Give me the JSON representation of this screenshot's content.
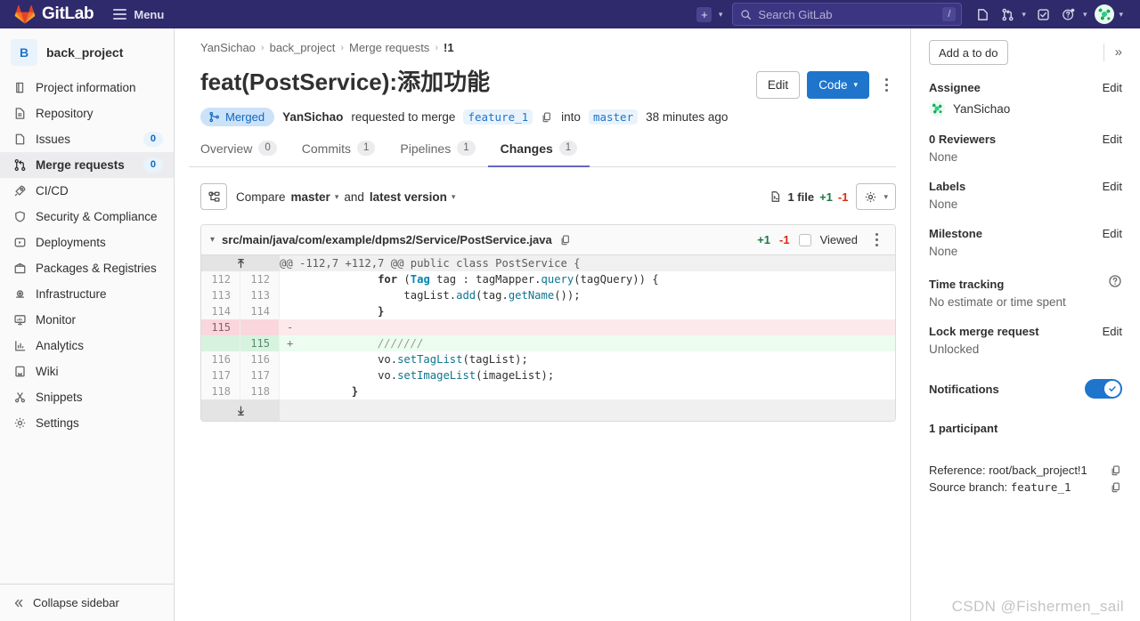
{
  "topnav": {
    "brand": "GitLab",
    "menu_label": "Menu",
    "search_placeholder": "Search GitLab",
    "search_value": "",
    "slash_key": "/",
    "plus_icon": "plus-icon",
    "icons": [
      "issues-icon",
      "merge-requests-icon",
      "todos-icon",
      "help-icon",
      "user-avatar"
    ]
  },
  "sidebar": {
    "project_initial": "B",
    "project_name": "back_project",
    "items": [
      {
        "label": "Project information",
        "icon": "project-info-icon",
        "badge": "",
        "active": false
      },
      {
        "label": "Repository",
        "icon": "repository-icon",
        "badge": "",
        "active": false
      },
      {
        "label": "Issues",
        "icon": "issues-icon",
        "badge": "0",
        "active": false
      },
      {
        "label": "Merge requests",
        "icon": "merge-requests-icon",
        "badge": "0",
        "active": true
      },
      {
        "label": "CI/CD",
        "icon": "rocket-icon",
        "badge": "",
        "active": false
      },
      {
        "label": "Security & Compliance",
        "icon": "shield-icon",
        "badge": "",
        "active": false
      },
      {
        "label": "Deployments",
        "icon": "deployments-icon",
        "badge": "",
        "active": false
      },
      {
        "label": "Packages & Registries",
        "icon": "package-icon",
        "badge": "",
        "active": false
      },
      {
        "label": "Infrastructure",
        "icon": "infrastructure-icon",
        "badge": "",
        "active": false
      },
      {
        "label": "Monitor",
        "icon": "monitor-icon",
        "badge": "",
        "active": false
      },
      {
        "label": "Analytics",
        "icon": "analytics-icon",
        "badge": "",
        "active": false
      },
      {
        "label": "Wiki",
        "icon": "wiki-icon",
        "badge": "",
        "active": false
      },
      {
        "label": "Snippets",
        "icon": "snippets-icon",
        "badge": "",
        "active": false
      },
      {
        "label": "Settings",
        "icon": "gear-icon",
        "badge": "",
        "active": false
      }
    ],
    "collapse_label": "Collapse sidebar"
  },
  "breadcrumb": [
    {
      "label": "YanSichao",
      "current": false
    },
    {
      "label": "back_project",
      "current": false
    },
    {
      "label": "Merge requests",
      "current": false
    },
    {
      "label": "!1",
      "current": true
    }
  ],
  "header": {
    "title": "feat(PostService):添加功能",
    "edit_label": "Edit",
    "code_label": "Code"
  },
  "meta": {
    "state_badge": "Merged",
    "author": "YanSichao",
    "requested_text": "requested to merge",
    "source_branch": "feature_1",
    "into_text": "into",
    "target_branch": "master",
    "time": "38 minutes ago"
  },
  "tabs": [
    {
      "label": "Overview",
      "count": "0",
      "active": false
    },
    {
      "label": "Commits",
      "count": "1",
      "active": false
    },
    {
      "label": "Pipelines",
      "count": "1",
      "active": false
    },
    {
      "label": "Changes",
      "count": "1",
      "active": true
    }
  ],
  "compare": {
    "tree_icon": "file-tree-icon",
    "prefix": "Compare",
    "base": "master",
    "and": "and",
    "version": "latest version",
    "file_count": "1 file",
    "additions": "+1",
    "deletions": "-1",
    "settings_icon": "gear-icon"
  },
  "diff": {
    "file_path": "src/main/java/com/example/dpms2/Service/PostService.java",
    "additions": "+1",
    "deletions": "-1",
    "viewed_label": "Viewed",
    "viewed_checked": false,
    "hunk_header": "@@ -112,7 +112,7 @@ public class PostService {",
    "lines": [
      {
        "type": "ctx",
        "old": "112",
        "new": "112",
        "sign": "",
        "code": "            for (Tag tag : tagMapper.query(tagQuery)) {"
      },
      {
        "type": "ctx",
        "old": "113",
        "new": "113",
        "sign": "",
        "code": "                tagList.add(tag.getName());"
      },
      {
        "type": "ctx",
        "old": "114",
        "new": "114",
        "sign": "",
        "code": "            }"
      },
      {
        "type": "del",
        "old": "115",
        "new": "",
        "sign": "-",
        "code": ""
      },
      {
        "type": "add",
        "old": "",
        "new": "115",
        "sign": "+",
        "code": "            ///////"
      },
      {
        "type": "ctx",
        "old": "116",
        "new": "116",
        "sign": "",
        "code": "            vo.setTagList(tagList);"
      },
      {
        "type": "ctx",
        "old": "117",
        "new": "117",
        "sign": "",
        "code": "            vo.setImageList(imageList);"
      },
      {
        "type": "ctx",
        "old": "118",
        "new": "118",
        "sign": "",
        "code": "        }"
      }
    ]
  },
  "rsidebar": {
    "todo_label": "Add a to do",
    "collapse_icon": "chevron-double-right-icon",
    "assignee": {
      "heading": "Assignee",
      "edit": "Edit",
      "user": "YanSichao"
    },
    "reviewers": {
      "heading": "0 Reviewers",
      "edit": "Edit",
      "value": "None"
    },
    "labels": {
      "heading": "Labels",
      "edit": "Edit",
      "value": "None"
    },
    "milestone": {
      "heading": "Milestone",
      "edit": "Edit",
      "value": "None"
    },
    "time_tracking": {
      "heading": "Time tracking",
      "value": "No estimate or time spent",
      "help_icon": "question-circle-icon"
    },
    "lock": {
      "heading": "Lock merge request",
      "edit": "Edit",
      "value": "Unlocked"
    },
    "notifications": {
      "heading": "Notifications",
      "enabled": true
    },
    "participants": {
      "heading": "1 participant"
    },
    "reference_line": "Reference: root/back_project!1",
    "source_branch_label": "Source branch: ",
    "source_branch_value": "feature_1"
  },
  "watermark": "CSDN @Fishermen_sail"
}
